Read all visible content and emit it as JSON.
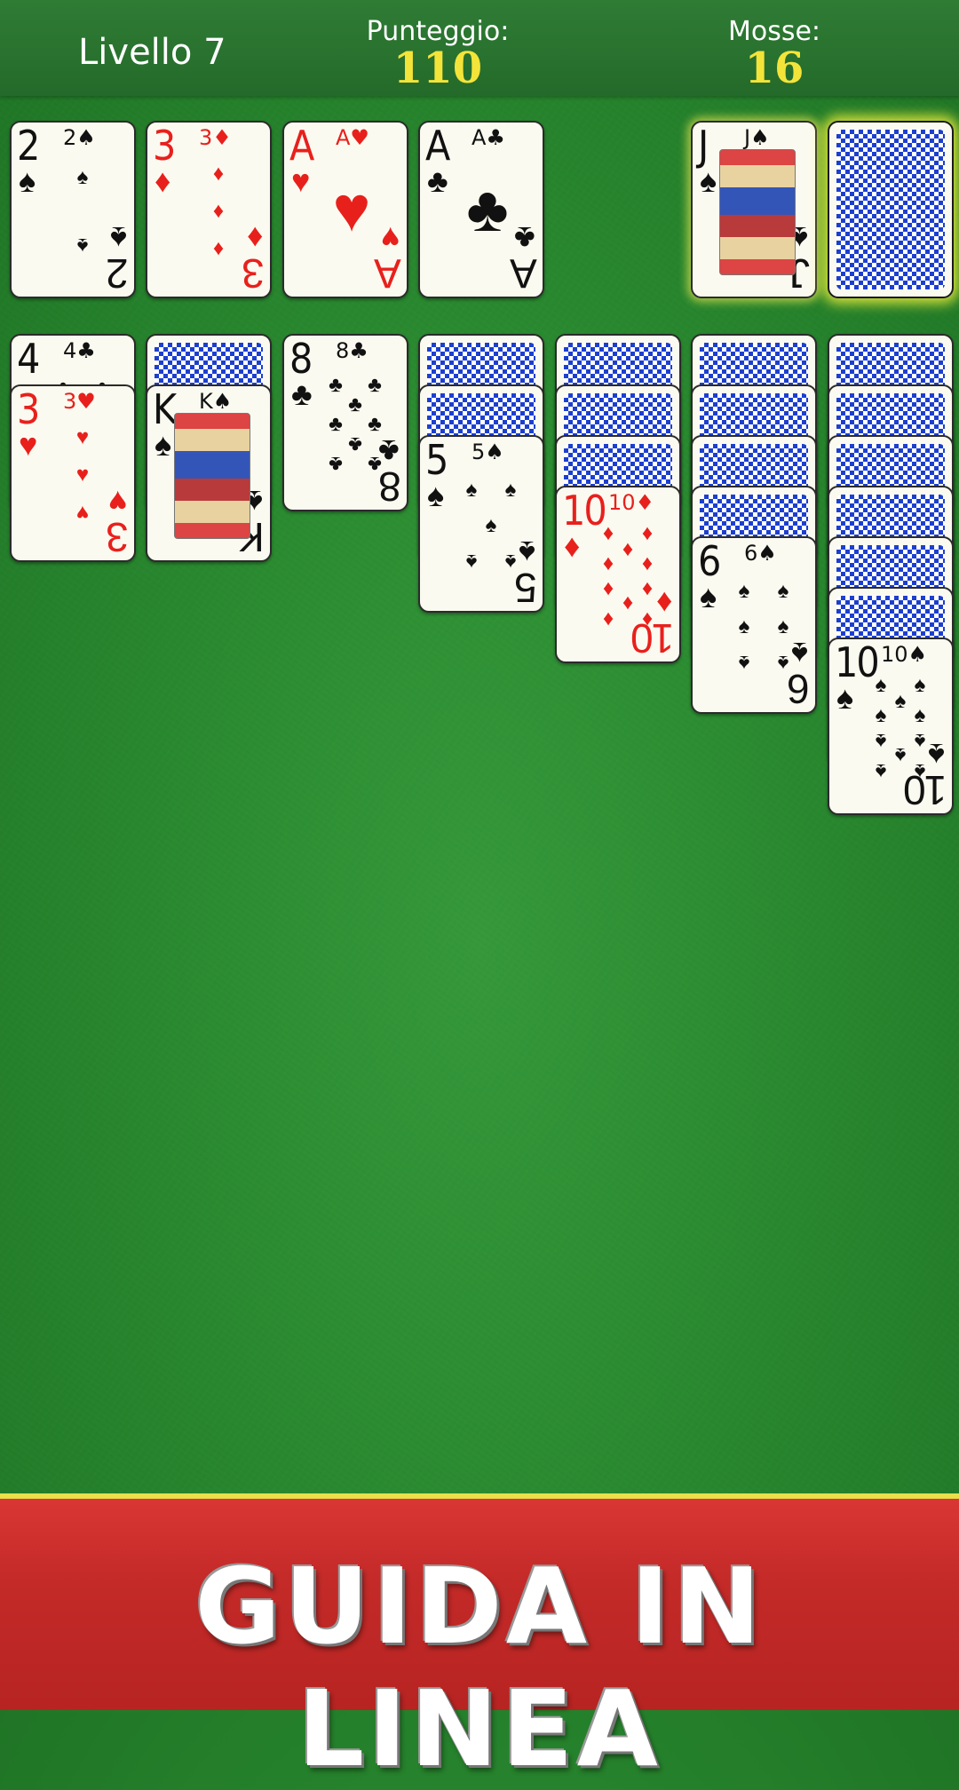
{
  "header": {
    "level_label": "Livello 7",
    "score_label": "Punteggio:",
    "score_value": "110",
    "moves_label": "Mosse:",
    "moves_value": "16"
  },
  "foundations": [
    {
      "rank": "2",
      "suit": "♠",
      "color": "black"
    },
    {
      "rank": "3",
      "suit": "♦",
      "color": "red"
    },
    {
      "rank": "A",
      "suit": "♥",
      "color": "red"
    },
    {
      "rank": "A",
      "suit": "♣",
      "color": "black"
    }
  ],
  "waste": {
    "rank": "J",
    "suit": "♠",
    "color": "black"
  },
  "stock": {
    "state": "face-down"
  },
  "tableau": [
    {
      "hidden": 0,
      "faceup": [
        {
          "rank": "4",
          "suit": "♣"
        },
        {
          "rank": "3",
          "suit": "♥"
        }
      ]
    },
    {
      "hidden": 1,
      "faceup": [
        {
          "rank": "K",
          "suit": "♠"
        }
      ]
    },
    {
      "hidden": 0,
      "faceup": [
        {
          "rank": "8",
          "suit": "♣"
        }
      ]
    },
    {
      "hidden": 2,
      "faceup": [
        {
          "rank": "5",
          "suit": "♠"
        }
      ]
    },
    {
      "hidden": 3,
      "faceup": [
        {
          "rank": "10",
          "suit": "♦"
        }
      ]
    },
    {
      "hidden": 4,
      "faceup": [
        {
          "rank": "6",
          "suit": "♠"
        }
      ]
    },
    {
      "hidden": 6,
      "faceup": [
        {
          "rank": "10",
          "suit": "♠"
        }
      ]
    }
  ],
  "banner": {
    "text": "GUIDA IN LINEA"
  },
  "colors": {
    "felt": "#2a8a30",
    "accent": "#f4e43a",
    "banner": "#c32a28",
    "card_back": "#1c3fd0"
  }
}
